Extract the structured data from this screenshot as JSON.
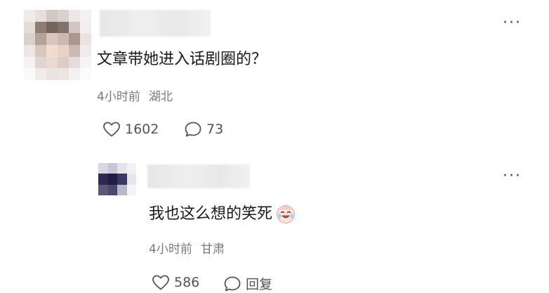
{
  "comments": [
    {
      "text": "文章带她进入话剧圈的？",
      "time": "4小时前",
      "location": "湖北",
      "likes": "1602",
      "replies": "73",
      "more": "···"
    },
    {
      "text": "我也这么想的笑死",
      "emoji": "crying-laughing-emoji",
      "time": "4小时前",
      "location": "甘肃",
      "likes": "586",
      "reply_label": "回复",
      "more": "···"
    }
  ],
  "icons": {
    "like": "heart-outline-icon",
    "reply": "speech-bubble-icon",
    "more": "more-dots-icon"
  },
  "colors": {
    "text": "#1a1a1a",
    "meta": "#7a7a7a",
    "action": "#555555"
  }
}
